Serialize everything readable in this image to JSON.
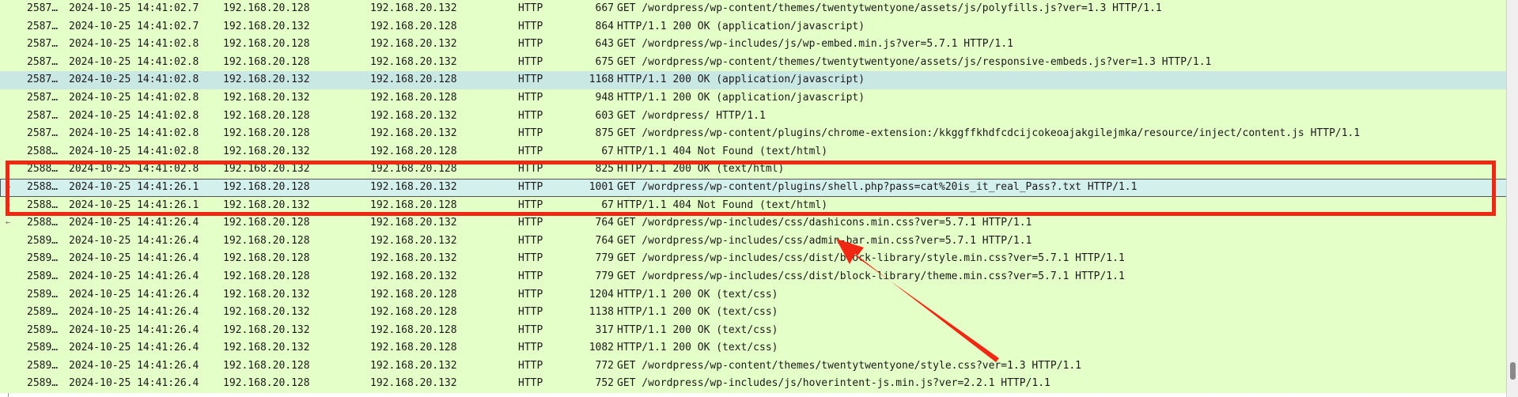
{
  "colors": {
    "row_bg": "#e4ffc7",
    "selected_bg": "#c9e8e4",
    "annotation": "#f02712"
  },
  "packets": [
    {
      "no": "2587…",
      "time": "2024-10-25 14:41:02.7",
      "src": "192.168.20.128",
      "dst": "192.168.20.132",
      "proto": "HTTP",
      "len": "667",
      "info": "GET /wordpress/wp-content/themes/twentytwentyone/assets/js/polyfills.js?ver=1.3 HTTP/1.1"
    },
    {
      "no": "2587…",
      "time": "2024-10-25 14:41:02.7",
      "src": "192.168.20.132",
      "dst": "192.168.20.128",
      "proto": "HTTP",
      "len": "864",
      "info": "HTTP/1.1 200 OK  (application/javascript)"
    },
    {
      "no": "2587…",
      "time": "2024-10-25 14:41:02.8",
      "src": "192.168.20.128",
      "dst": "192.168.20.132",
      "proto": "HTTP",
      "len": "643",
      "info": "GET /wordpress/wp-includes/js/wp-embed.min.js?ver=5.7.1 HTTP/1.1"
    },
    {
      "no": "2587…",
      "time": "2024-10-25 14:41:02.8",
      "src": "192.168.20.128",
      "dst": "192.168.20.132",
      "proto": "HTTP",
      "len": "675",
      "info": "GET /wordpress/wp-content/themes/twentytwentyone/assets/js/responsive-embeds.js?ver=1.3 HTTP/1.1"
    },
    {
      "no": "2587…",
      "time": "2024-10-25 14:41:02.8",
      "src": "192.168.20.132",
      "dst": "192.168.20.128",
      "proto": "HTTP",
      "len": "1168",
      "info": "HTTP/1.1 200 OK  (application/javascript)",
      "state": "sel"
    },
    {
      "no": "2587…",
      "time": "2024-10-25 14:41:02.8",
      "src": "192.168.20.132",
      "dst": "192.168.20.128",
      "proto": "HTTP",
      "len": "948",
      "info": "HTTP/1.1 200 OK  (application/javascript)"
    },
    {
      "no": "2587…",
      "time": "2024-10-25 14:41:02.8",
      "src": "192.168.20.128",
      "dst": "192.168.20.132",
      "proto": "HTTP",
      "len": "603",
      "info": "GET /wordpress/ HTTP/1.1"
    },
    {
      "no": "2587…",
      "time": "2024-10-25 14:41:02.8",
      "src": "192.168.20.128",
      "dst": "192.168.20.132",
      "proto": "HTTP",
      "len": "875",
      "info": "GET /wordpress/wp-content/plugins/chrome-extension:/kkggffkhdfcdcijcokeoajakgilejmka/resource/inject/content.js HTTP/1.1"
    },
    {
      "no": "2588…",
      "time": "2024-10-25 14:41:02.8",
      "src": "192.168.20.132",
      "dst": "192.168.20.128",
      "proto": "HTTP",
      "len": "67",
      "info": "HTTP/1.1 404 Not Found  (text/html)"
    },
    {
      "no": "2588…",
      "time": "2024-10-25 14:41:02.8",
      "src": "192.168.20.132",
      "dst": "192.168.20.128",
      "proto": "HTTP",
      "len": "825",
      "info": "HTTP/1.1 200 OK  (text/html)"
    },
    {
      "no": "2588…",
      "time": "2024-10-25 14:41:26.1",
      "src": "192.168.20.128",
      "dst": "192.168.20.132",
      "proto": "HTTP",
      "len": "1001",
      "info": "GET /wordpress/wp-content/plugins/shell.php?pass=cat%20is_it_real_Pass?.txt HTTP/1.1",
      "state": "focus"
    },
    {
      "no": "2588…",
      "time": "2024-10-25 14:41:26.1",
      "src": "192.168.20.132",
      "dst": "192.168.20.128",
      "proto": "HTTP",
      "len": "67",
      "info": "HTTP/1.1 404 Not Found  (text/html)"
    },
    {
      "no": "2588…",
      "time": "2024-10-25 14:41:26.4",
      "src": "192.168.20.128",
      "dst": "192.168.20.132",
      "proto": "HTTP",
      "len": "764",
      "info": "GET /wordpress/wp-includes/css/dashicons.min.css?ver=5.7.1 HTTP/1.1"
    },
    {
      "no": "2589…",
      "time": "2024-10-25 14:41:26.4",
      "src": "192.168.20.128",
      "dst": "192.168.20.132",
      "proto": "HTTP",
      "len": "764",
      "info": "GET /wordpress/wp-includes/css/admin-bar.min.css?ver=5.7.1 HTTP/1.1"
    },
    {
      "no": "2589…",
      "time": "2024-10-25 14:41:26.4",
      "src": "192.168.20.128",
      "dst": "192.168.20.132",
      "proto": "HTTP",
      "len": "779",
      "info": "GET /wordpress/wp-includes/css/dist/block-library/style.min.css?ver=5.7.1 HTTP/1.1"
    },
    {
      "no": "2589…",
      "time": "2024-10-25 14:41:26.4",
      "src": "192.168.20.128",
      "dst": "192.168.20.132",
      "proto": "HTTP",
      "len": "779",
      "info": "GET /wordpress/wp-includes/css/dist/block-library/theme.min.css?ver=5.7.1 HTTP/1.1"
    },
    {
      "no": "2589…",
      "time": "2024-10-25 14:41:26.4",
      "src": "192.168.20.132",
      "dst": "192.168.20.128",
      "proto": "HTTP",
      "len": "1204",
      "info": "HTTP/1.1 200 OK  (text/css)"
    },
    {
      "no": "2589…",
      "time": "2024-10-25 14:41:26.4",
      "src": "192.168.20.132",
      "dst": "192.168.20.128",
      "proto": "HTTP",
      "len": "1138",
      "info": "HTTP/1.1 200 OK  (text/css)"
    },
    {
      "no": "2589…",
      "time": "2024-10-25 14:41:26.4",
      "src": "192.168.20.132",
      "dst": "192.168.20.128",
      "proto": "HTTP",
      "len": "317",
      "info": "HTTP/1.1 200 OK  (text/css)"
    },
    {
      "no": "2589…",
      "time": "2024-10-25 14:41:26.4",
      "src": "192.168.20.132",
      "dst": "192.168.20.128",
      "proto": "HTTP",
      "len": "1082",
      "info": "HTTP/1.1 200 OK  (text/css)"
    },
    {
      "no": "2589…",
      "time": "2024-10-25 14:41:26.4",
      "src": "192.168.20.128",
      "dst": "192.168.20.132",
      "proto": "HTTP",
      "len": "772",
      "info": "GET /wordpress/wp-content/themes/twentytwentyone/style.css?ver=1.3 HTTP/1.1"
    },
    {
      "no": "2589…",
      "time": "2024-10-25 14:41:26.4",
      "src": "192.168.20.128",
      "dst": "192.168.20.132",
      "proto": "HTTP",
      "len": "752",
      "info": "GET /wordpress/wp-includes/js/hoverintent-js.min.js?ver=2.2.1 HTTP/1.1"
    }
  ]
}
